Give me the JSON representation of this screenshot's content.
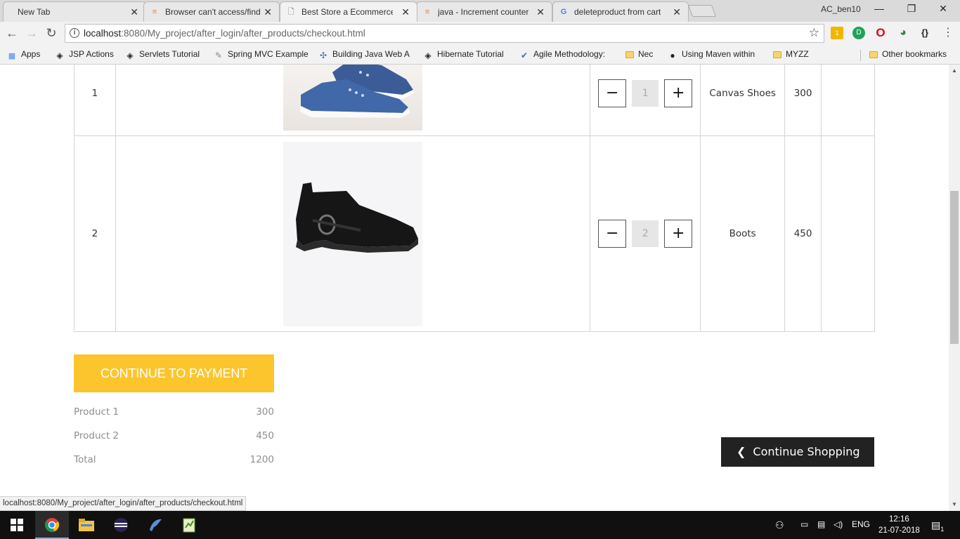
{
  "browser": {
    "tabs": [
      {
        "title": "New Tab",
        "icon": "none"
      },
      {
        "title": "Browser can't access/find",
        "icon": "stackoverflow-icon"
      },
      {
        "title": "Best Store a Ecommerce",
        "icon": "page-icon"
      },
      {
        "title": "java - Increment counter",
        "icon": "stackoverflow-icon"
      },
      {
        "title": "deleteproduct from cart",
        "icon": "google-icon"
      }
    ],
    "profile_name": "AC_ben10",
    "url_host": "localhost",
    "url_rest": ":8080/My_project/after_login/after_products/checkout.html",
    "extension_badge": "1",
    "bookmarks": [
      {
        "label": "Apps"
      },
      {
        "label": "JSP Actions"
      },
      {
        "label": "Servlets Tutorial"
      },
      {
        "label": "Spring MVC Example"
      },
      {
        "label": "Building Java Web A"
      },
      {
        "label": "Hibernate Tutorial"
      },
      {
        "label": "Agile Methodology:"
      },
      {
        "label": "Nec"
      },
      {
        "label": "Using Maven within"
      },
      {
        "label": "MYZZ"
      },
      {
        "label": "Other bookmarks"
      }
    ]
  },
  "cart": {
    "rows": [
      {
        "no": "1",
        "image": "canvas-shoe",
        "qty": "1",
        "name": "Canvas Shoes",
        "price": "300"
      },
      {
        "no": "2",
        "image": "black-boot",
        "qty": "2",
        "name": "Boots",
        "price": "450"
      }
    ],
    "minus_symbol": "−",
    "plus_symbol": "+"
  },
  "checkout": {
    "pay_label": "CONTINUE TO PAYMENT",
    "summary": [
      {
        "label": "Product 1",
        "value": "300"
      },
      {
        "label": "Product 2",
        "value": "450"
      },
      {
        "label": "Total",
        "value": "1200"
      }
    ],
    "continue_label": "Continue Shopping"
  },
  "status_url": "localhost:8080/My_project/after_login/after_products/checkout.html",
  "taskbar": {
    "language": "ENG",
    "time": "12:16",
    "date": "21-07-2018",
    "notification_count": "1"
  },
  "colors": {
    "pay_button": "#fcc52d",
    "continue_button": "#222222"
  }
}
